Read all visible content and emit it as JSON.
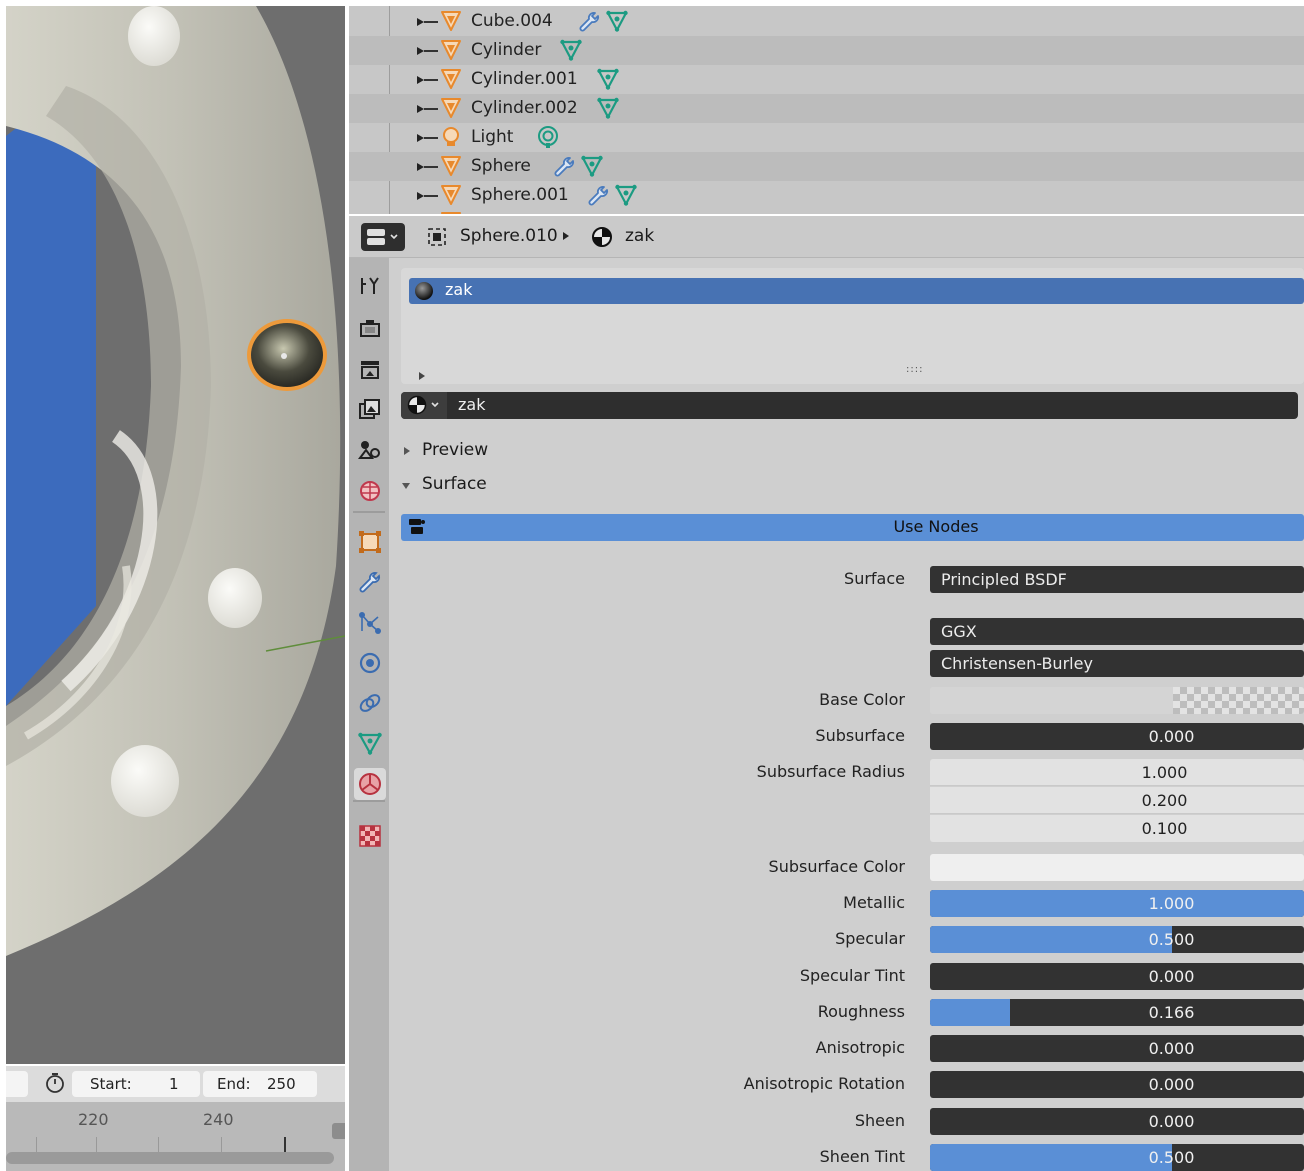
{
  "outliner": {
    "items": [
      {
        "name": "Cube.004",
        "type": "mesh",
        "extras": [
          "modifier",
          "mesh-data"
        ]
      },
      {
        "name": "Cylinder",
        "type": "mesh",
        "extras": [
          "mesh-data"
        ]
      },
      {
        "name": "Cylinder.001",
        "type": "mesh",
        "extras": [
          "mesh-data"
        ]
      },
      {
        "name": "Cylinder.002",
        "type": "mesh",
        "extras": [
          "mesh-data"
        ]
      },
      {
        "name": "Light",
        "type": "light",
        "extras": [
          "light-data"
        ]
      },
      {
        "name": "Sphere",
        "type": "mesh",
        "extras": [
          "modifier",
          "mesh-data"
        ]
      },
      {
        "name": "Sphere.001",
        "type": "mesh",
        "extras": [
          "modifier",
          "mesh-data"
        ]
      }
    ]
  },
  "timeline": {
    "start_label": "Start:",
    "start_value": "1",
    "end_label": "End:",
    "end_value": "250",
    "ruler": [
      "220",
      "240"
    ]
  },
  "properties": {
    "breadcrumb": {
      "object": "Sphere.010",
      "material": "zak"
    },
    "material_slot": "zak",
    "material_name": "zak",
    "panels": {
      "preview": "Preview",
      "surface": "Surface"
    },
    "use_nodes": "Use Nodes",
    "surface_label": "Surface",
    "surface_value": "Principled BSDF",
    "distribution": "GGX",
    "subsurface_method": "Christensen-Burley",
    "fields": {
      "base_color": "Base Color",
      "subsurface": {
        "label": "Subsurface",
        "value": "0.000",
        "fraction": 0
      },
      "subsurface_radius": {
        "label": "Subsurface Radius",
        "values": [
          "1.000",
          "0.200",
          "0.100"
        ]
      },
      "subsurface_color": "Subsurface Color",
      "metallic": {
        "label": "Metallic",
        "value": "1.000",
        "fraction": 1.0
      },
      "specular": {
        "label": "Specular",
        "value": "0.500",
        "fraction": 0.5
      },
      "specular_tint": {
        "label": "Specular Tint",
        "value": "0.000",
        "fraction": 0
      },
      "roughness": {
        "label": "Roughness",
        "value": "0.166",
        "fraction": 0.166
      },
      "anisotropic": {
        "label": "Anisotropic",
        "value": "0.000",
        "fraction": 0
      },
      "anisotropic_rotation": {
        "label": "Anisotropic Rotation",
        "value": "0.000",
        "fraction": 0
      },
      "sheen": {
        "label": "Sheen",
        "value": "0.000",
        "fraction": 0
      },
      "sheen_tint": {
        "label": "Sheen Tint",
        "value": "0.500",
        "fraction": 0.5
      }
    }
  },
  "colors": {
    "accent": "#5a8fd6",
    "selected_row": "#4772b3",
    "field_dark": "#323232",
    "mesh_icon": "#e8892c",
    "data_icon": "#1c9b82",
    "modifier_icon": "#4a7bbd"
  }
}
